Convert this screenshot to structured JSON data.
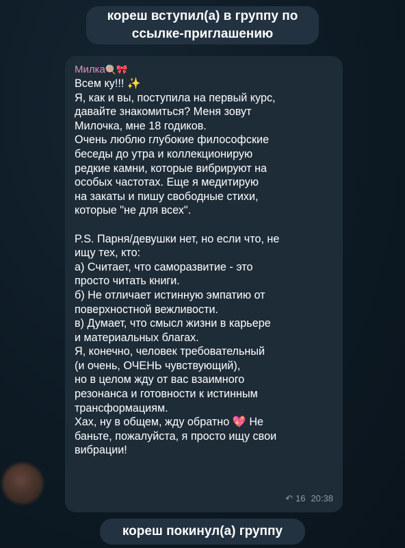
{
  "service": {
    "joined": "кореш вступил(а) в группу по ссылке-приглашению",
    "left": "кореш покинул(а) группу"
  },
  "message": {
    "sender": "Милка",
    "sender_emoji": "🍭🎀",
    "lines": [
      "Всем ку!!! ✨",
      "Я, как и вы, поступила на первый курс,",
      "давайте знакомиться? Меня зовут",
      "Милочка, мне 18 годиков.",
      "Очень люблю глубокие философские",
      "беседы до утра и коллекционирую",
      "редкие камни, которые вибрируют на",
      "особых частотах. Еще я медитирую",
      "на закаты и пишу свободные стихи,",
      "которые \"не для всех\".",
      "",
      "P.S. Парня/девушки нет, но если что, не",
      "ищу тех, кто:",
      "а) Считает, что саморазвитие - это",
      "просто читать книги.",
      "б) Не отличает истинную эмпатию от",
      "поверхностной вежливости.",
      "в) Думает, что смысл жизни в карьере",
      "и материальных благах.",
      "Я, конечно, человек требовательный",
      "(и очень, ОЧЕНЬ чувствующий),",
      "но в целом жду от вас взаимного",
      "резонанса и готовности к истинным",
      "трансформациям."
    ],
    "closing_before_heart": "Хах, ну в общем, жду обратно ",
    "heart_emoji": "💖",
    "closing_after_heart": " Не",
    "closing_lines": [
      "баньте, пожалуйста, я просто ищу свои",
      "вибрации!"
    ],
    "views": "16",
    "time": "20:38"
  },
  "colors": {
    "background": "#0b1620",
    "bubble": "#1e2c38",
    "service_pill": "#223240",
    "sender": "#e58fbf",
    "meta": "#8a9aa8"
  },
  "icons": {
    "reply": "reply-arrow-icon",
    "avatar": "user-avatar"
  }
}
